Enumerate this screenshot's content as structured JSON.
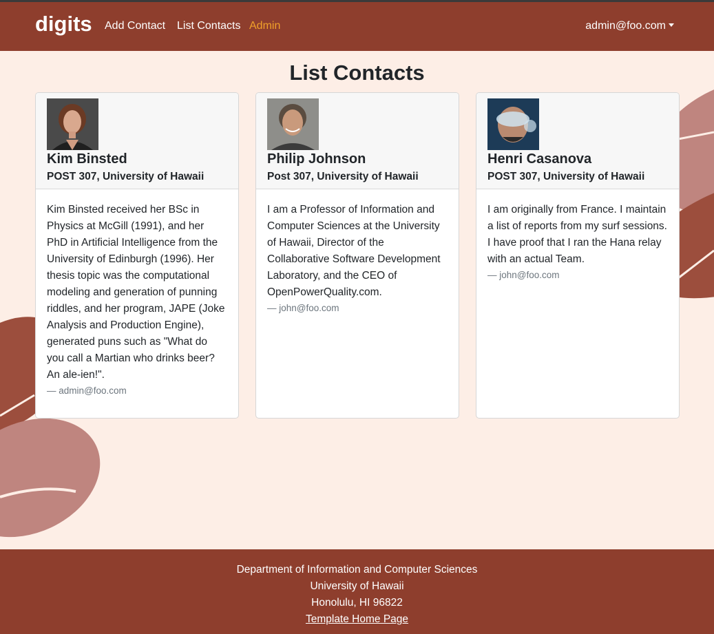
{
  "navbar": {
    "brand": "digits",
    "links": [
      "Add Contact",
      "List Contacts",
      "Admin"
    ],
    "user": "admin@foo.com"
  },
  "page": {
    "title": "List Contacts"
  },
  "contacts": [
    {
      "name": "Kim Binsted",
      "address": "POST 307, University of Hawaii",
      "description": "Kim Binsted received her BSc in Physics at McGill (1991), and her PhD in Artificial Intelligence from the University of Edinburgh (1996). Her thesis topic was the computational modeling and generation of punning riddles, and her program, JAPE (Joke Analysis and Production Engine), generated puns such as \"What do you call a Martian who drinks beer? An ale-ien!\".",
      "owner": "— admin@foo.com"
    },
    {
      "name": "Philip Johnson",
      "address": "Post 307, University of Hawaii",
      "description": "I am a Professor of Information and Computer Sciences at the University of Hawaii, Director of the Collaborative Software Development Laboratory, and the CEO of OpenPowerQuality.com.",
      "owner": "— john@foo.com"
    },
    {
      "name": "Henri Casanova",
      "address": "POST 307, University of Hawaii",
      "description": "I am originally from France. I maintain a list of reports from my surf sessions. I have proof that I ran the Hana relay with an actual Team.",
      "owner": "— john@foo.com"
    }
  ],
  "footer": {
    "line1": "Department of Information and Computer Sciences",
    "line2": "University of Hawaii",
    "line3": "Honolulu, HI 96822",
    "link": "Template Home Page"
  },
  "colors": {
    "navbar": "#8e3e2d",
    "background": "#fdeee6",
    "admin_link": "#f0a02a"
  }
}
